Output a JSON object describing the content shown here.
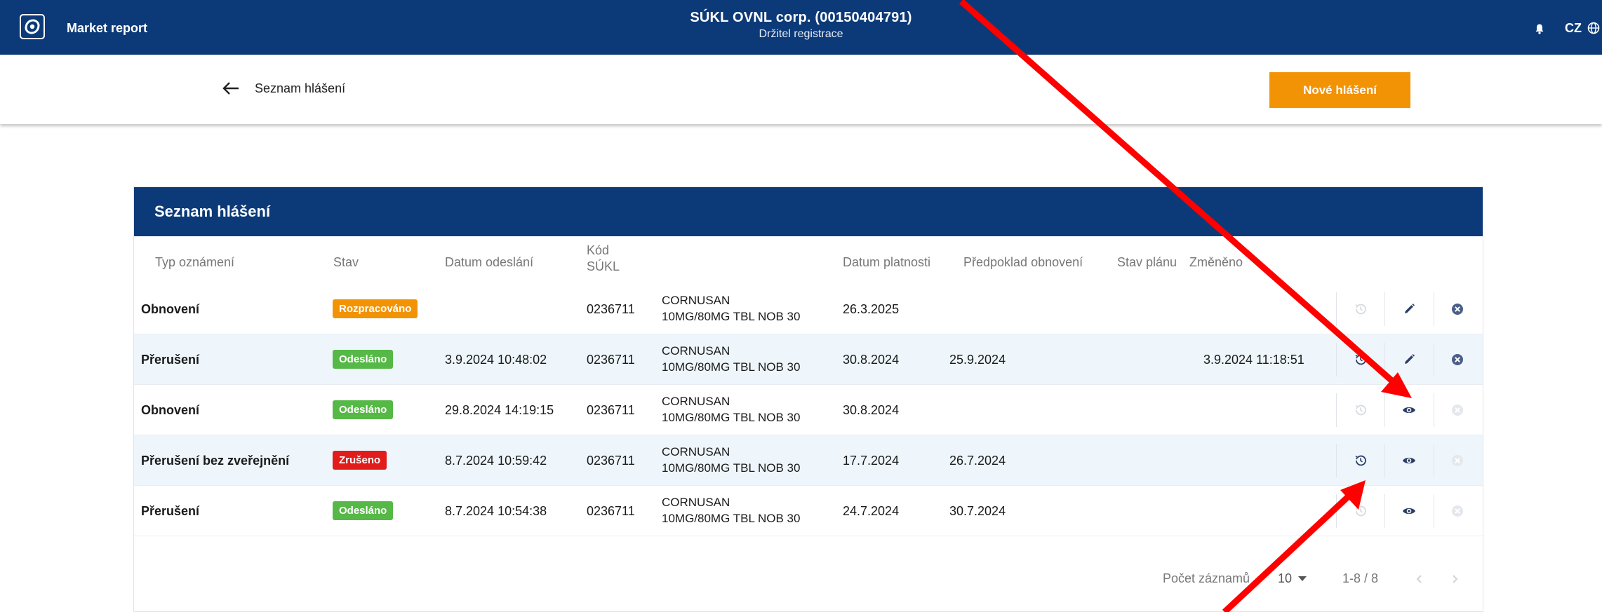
{
  "header": {
    "app_title": "Market report",
    "org_name": "SÚKL OVNL corp. (00150404791)",
    "org_role": "Držitel registrace",
    "language": "CZ",
    "icons": [
      "app-logo-icon",
      "bell-icon",
      "globe-icon"
    ]
  },
  "subheader": {
    "back_label": "Seznam hlášení",
    "new_button_label": "Nové hlášení"
  },
  "table": {
    "title": "Seznam hlášení",
    "columns": {
      "typ": "Typ oznámení",
      "stav": "Stav",
      "datum_odeslani": "Datum odeslání",
      "kod_sukl_line1": "Kód",
      "kod_sukl_line2": "SÚKL",
      "datum_platnosti": "Datum platnosti",
      "predpoklad": "Předpoklad obnovení",
      "stav_planu": "Stav plánu",
      "zmeneno": "Změněno"
    },
    "rows": [
      {
        "typ": "Obnovení",
        "stav": "Rozpracováno",
        "datum_odeslani": "",
        "kod": "0236711",
        "nazev1": "CORNUSAN",
        "nazev2": "10MG/80MG TBL NOB 30",
        "platnost": "26.3.2025",
        "predpoklad": "",
        "stav_planu": "",
        "zmeneno": ""
      },
      {
        "typ": "Přerušení",
        "stav": "Odesláno",
        "datum_odeslani": "3.9.2024 10:48:02",
        "kod": "0236711",
        "nazev1": "CORNUSAN",
        "nazev2": "10MG/80MG TBL NOB 30",
        "platnost": "30.8.2024",
        "predpoklad": "25.9.2024",
        "stav_planu": "",
        "zmeneno": "3.9.2024 11:18:51"
      },
      {
        "typ": "Obnovení",
        "stav": "Odesláno",
        "datum_odeslani": "29.8.2024 14:19:15",
        "kod": "0236711",
        "nazev1": "CORNUSAN",
        "nazev2": "10MG/80MG TBL NOB 30",
        "platnost": "30.8.2024",
        "predpoklad": "",
        "stav_planu": "",
        "zmeneno": ""
      },
      {
        "typ": "Přerušení bez zveřejnění",
        "stav": "Zrušeno",
        "datum_odeslani": "8.7.2024 10:59:42",
        "kod": "0236711",
        "nazev1": "CORNUSAN",
        "nazev2": "10MG/80MG TBL NOB 30",
        "platnost": "17.7.2024",
        "predpoklad": "26.7.2024",
        "stav_planu": "",
        "zmeneno": ""
      },
      {
        "typ": "Přerušení",
        "stav": "Odesláno",
        "datum_odeslani": "8.7.2024 10:54:38",
        "kod": "0236711",
        "nazev1": "CORNUSAN",
        "nazev2": "10MG/80MG TBL NOB 30",
        "platnost": "24.7.2024",
        "predpoklad": "30.7.2024",
        "stav_planu": "",
        "zmeneno": ""
      }
    ],
    "row_actions": [
      "history-icon",
      "edit-icon",
      "eye-icon",
      "cancel-icon"
    ]
  },
  "pagination": {
    "label": "Počet záznamů",
    "page_size": "10",
    "range": "1-8 / 8"
  },
  "colors": {
    "primary": "#0c3a78",
    "accent_orange": "#f29306",
    "status_green": "#56b846",
    "status_red": "#e21b1b",
    "row_alt": "#eef6fc",
    "annotation_red": "#ff0000"
  }
}
